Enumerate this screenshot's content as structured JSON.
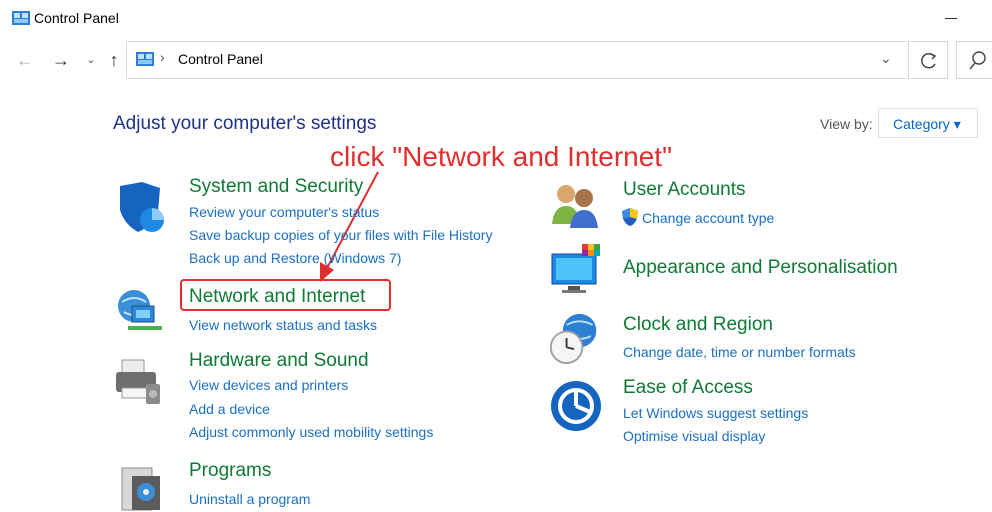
{
  "window": {
    "title": "Control Panel"
  },
  "address_bar": {
    "path": "Control Panel"
  },
  "main": {
    "heading": "Adjust your computer's settings",
    "view_by_label": "View by:",
    "view_by_value": "Category ▾"
  },
  "annotation": {
    "text": "click \"Network and Internet\"",
    "color": "#e22e2e"
  },
  "categories": [
    {
      "title": "System and Security",
      "icon": "security-shield-icon",
      "links": [
        "Review your computer's status",
        "Save backup copies of your files with File History",
        "Back up and Restore (Windows 7)"
      ]
    },
    {
      "title": "Network and Internet",
      "icon": "network-globe-icon",
      "links": [
        "View network status and tasks"
      ]
    },
    {
      "title": "Hardware and Sound",
      "icon": "printer-icon",
      "links": [
        "View devices and printers",
        "Add a device",
        "Adjust commonly used mobility settings"
      ]
    },
    {
      "title": "Programs",
      "icon": "programs-icon",
      "links": [
        "Uninstall a program"
      ]
    },
    {
      "title": "User Accounts",
      "icon": "users-icon",
      "links": [
        "Change account type"
      ]
    },
    {
      "title": "Appearance and Personalisation",
      "icon": "monitor-palette-icon",
      "links": []
    },
    {
      "title": "Clock and Region",
      "icon": "clock-globe-icon",
      "links": [
        "Change date, time or number formats"
      ]
    },
    {
      "title": "Ease of Access",
      "icon": "ease-of-access-icon",
      "links": [
        "Let Windows suggest settings",
        "Optimise visual display"
      ]
    }
  ],
  "colors": {
    "category_title": "#0f7a35",
    "link": "#1a6fc4",
    "heading": "#1e3287"
  }
}
